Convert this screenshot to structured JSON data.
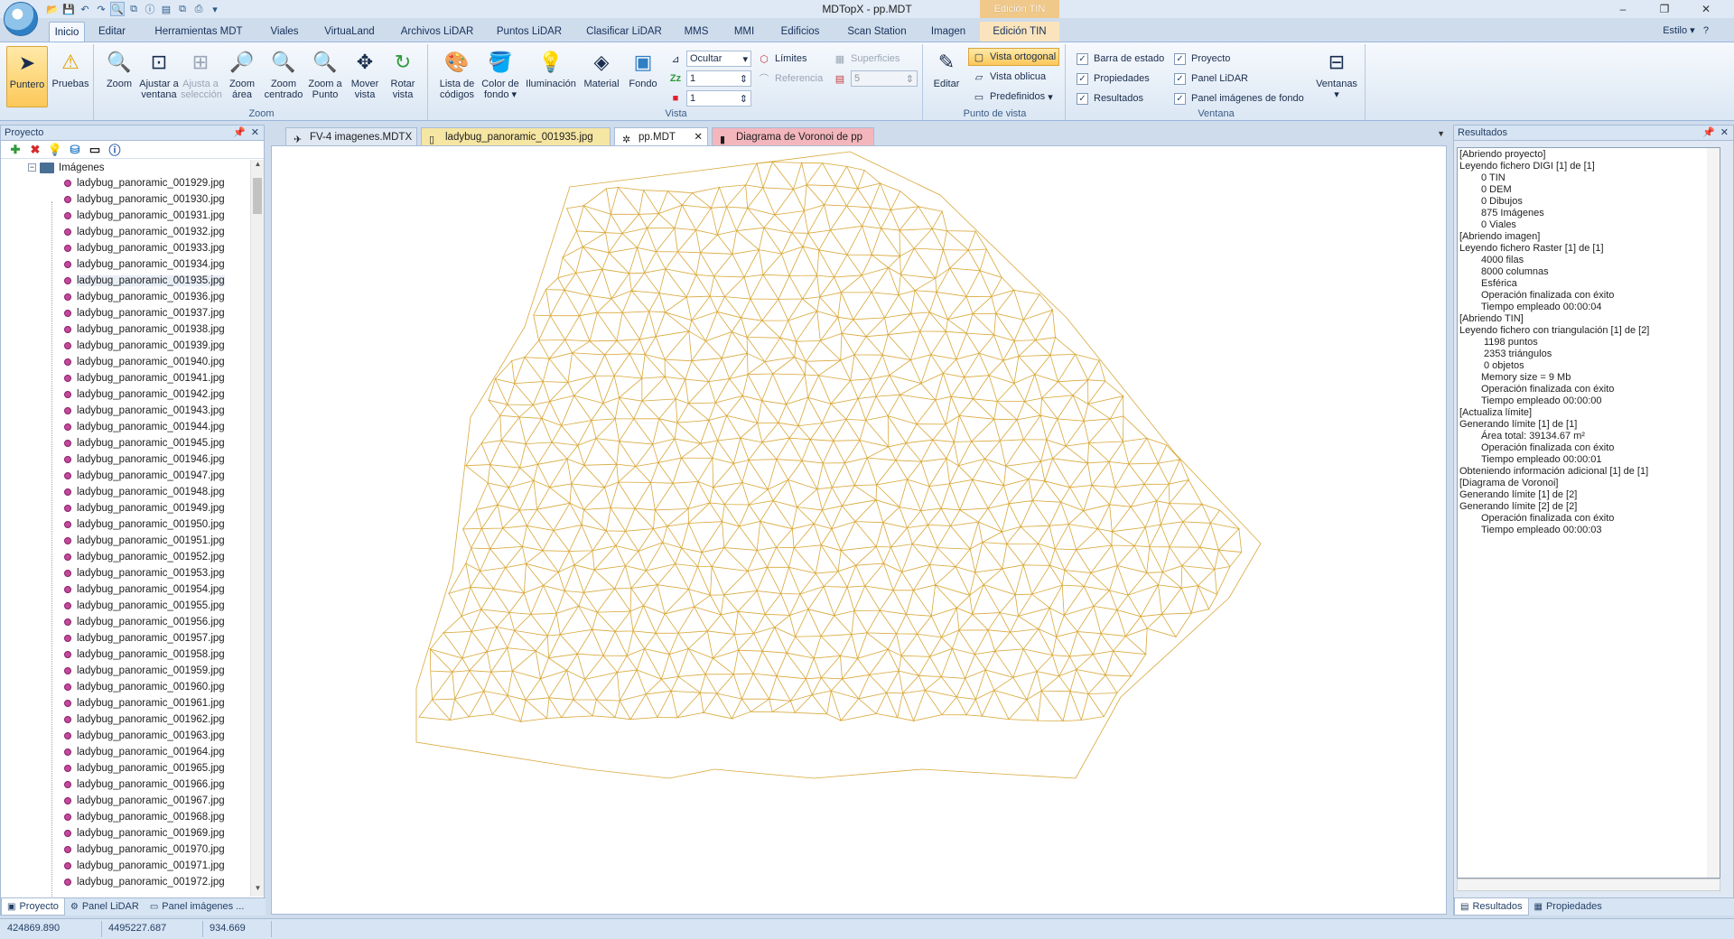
{
  "window": {
    "title": "MDTopX - pp.MDT",
    "context_tab_title": "Edición TIN",
    "minimize": "–",
    "restore": "❐",
    "close": "✕",
    "style_menu": "Estilo",
    "help": "?"
  },
  "ribbon_tabs": [
    "Inicio",
    "Editar",
    "Herramientas MDT",
    "Viales",
    "VirtuaLand",
    "Archivos LiDAR",
    "Puntos LiDAR",
    "Clasificar LiDAR",
    "MMS",
    "MMI",
    "Edificios",
    "Scan Station",
    "Imagen",
    "Edición TIN"
  ],
  "ribbon": {
    "puntero": "Puntero",
    "pruebas": "Pruebas",
    "zoom_group": {
      "label": "Zoom",
      "zoom": "Zoom",
      "ajustar_ventana": "Ajustar a ventana",
      "ajustar_seleccion": "Ajusta a selección",
      "zoom_area": "Zoom área",
      "zoom_centrado": "Zoom centrado",
      "zoom_punto": "Zoom a Punto",
      "mover_vista": "Mover vista",
      "rotar_vista": "Rotar vista"
    },
    "vista_group": {
      "label": "Vista",
      "lista_codigos": "Lista de códigos",
      "color_fondo": "Color de fondo",
      "iluminacion": "Iluminación",
      "material": "Material",
      "fondo": "Fondo",
      "ocultar": "Ocultar",
      "z_value": "1",
      "color_value": "1",
      "limites": "Límites",
      "referencia": "Referencia",
      "superficies": "Superficies",
      "superficies_value": "5"
    },
    "punto_vista_group": {
      "label": "Punto de vista",
      "editar": "Editar",
      "vista_ortogonal": "Vista ortogonal",
      "vista_oblicua": "Vista oblicua",
      "predefinidos": "Predefinidos"
    },
    "ventana_group": {
      "label": "Ventana",
      "barra_estado": "Barra de estado",
      "propiedades": "Propiedades",
      "resultados": "Resultados",
      "proyecto": "Proyecto",
      "panel_lidar": "Panel LiDAR",
      "panel_imagenes": "Panel imágenes de fondo",
      "ventanas": "Ventanas"
    }
  },
  "project_panel": {
    "title": "Proyecto",
    "root": "Imágenes",
    "items": [
      "ladybug_panoramic_001929.jpg",
      "ladybug_panoramic_001930.jpg",
      "ladybug_panoramic_001931.jpg",
      "ladybug_panoramic_001932.jpg",
      "ladybug_panoramic_001933.jpg",
      "ladybug_panoramic_001934.jpg",
      "ladybug_panoramic_001935.jpg",
      "ladybug_panoramic_001936.jpg",
      "ladybug_panoramic_001937.jpg",
      "ladybug_panoramic_001938.jpg",
      "ladybug_panoramic_001939.jpg",
      "ladybug_panoramic_001940.jpg",
      "ladybug_panoramic_001941.jpg",
      "ladybug_panoramic_001942.jpg",
      "ladybug_panoramic_001943.jpg",
      "ladybug_panoramic_001944.jpg",
      "ladybug_panoramic_001945.jpg",
      "ladybug_panoramic_001946.jpg",
      "ladybug_panoramic_001947.jpg",
      "ladybug_panoramic_001948.jpg",
      "ladybug_panoramic_001949.jpg",
      "ladybug_panoramic_001950.jpg",
      "ladybug_panoramic_001951.jpg",
      "ladybug_panoramic_001952.jpg",
      "ladybug_panoramic_001953.jpg",
      "ladybug_panoramic_001954.jpg",
      "ladybug_panoramic_001955.jpg",
      "ladybug_panoramic_001956.jpg",
      "ladybug_panoramic_001957.jpg",
      "ladybug_panoramic_001958.jpg",
      "ladybug_panoramic_001959.jpg",
      "ladybug_panoramic_001960.jpg",
      "ladybug_panoramic_001961.jpg",
      "ladybug_panoramic_001962.jpg",
      "ladybug_panoramic_001963.jpg",
      "ladybug_panoramic_001964.jpg",
      "ladybug_panoramic_001965.jpg",
      "ladybug_panoramic_001966.jpg",
      "ladybug_panoramic_001967.jpg",
      "ladybug_panoramic_001968.jpg",
      "ladybug_panoramic_001969.jpg",
      "ladybug_panoramic_001970.jpg",
      "ladybug_panoramic_001971.jpg",
      "ladybug_panoramic_001972.jpg"
    ],
    "tabs": [
      "Proyecto",
      "Panel LiDAR",
      "Panel imágenes ..."
    ]
  },
  "doc_tabs": [
    {
      "label": "FV-4 imagenes.MDTX",
      "bg": "#dfe8f3"
    },
    {
      "label": "ladybug_panoramic_001935.jpg",
      "bg": "#f6e6a3"
    },
    {
      "label": "pp.MDT",
      "bg": "#ffffff"
    },
    {
      "label": "Diagrama de Voronoi de pp",
      "bg": "#f4b6bd"
    }
  ],
  "tin": {
    "line_color": "#d9a83a"
  },
  "results_panel": {
    "title": "Resultados",
    "lines": [
      {
        "t": "[Abriendo proyecto]",
        "i": 0
      },
      {
        "t": "Leyendo fichero DIGI [1] de [1]",
        "i": 0
      },
      {
        "t": "0 TIN",
        "i": 1
      },
      {
        "t": "0 DEM",
        "i": 1
      },
      {
        "t": "0 Dibujos",
        "i": 1
      },
      {
        "t": "875 Imágenes",
        "i": 1
      },
      {
        "t": "0 Viales",
        "i": 1
      },
      {
        "t": "[Abriendo imagen]",
        "i": 0
      },
      {
        "t": "Leyendo fichero Raster [1] de [1]",
        "i": 0
      },
      {
        "t": "4000 filas",
        "i": 1
      },
      {
        "t": "8000 columnas",
        "i": 1
      },
      {
        "t": "Esférica",
        "i": 1
      },
      {
        "t": "Operación finalizada con éxito",
        "i": 1
      },
      {
        "t": "Tiempo empleado 00:00:04",
        "i": 1
      },
      {
        "t": "[Abriendo TIN]",
        "i": 0
      },
      {
        "t": "Leyendo fichero con triangulación [1] de [2]",
        "i": 0
      },
      {
        "t": "1198 puntos",
        "i": 2
      },
      {
        "t": "2353 triángulos",
        "i": 2
      },
      {
        "t": "0 objetos",
        "i": 2
      },
      {
        "t": "Memory size = 9 Mb",
        "i": 1
      },
      {
        "t": "Operación finalizada con éxito",
        "i": 1
      },
      {
        "t": "Tiempo empleado 00:00:00",
        "i": 1
      },
      {
        "t": "[Actualiza límite]",
        "i": 0
      },
      {
        "t": "Generando límite [1] de [1]",
        "i": 0
      },
      {
        "t": "Área total: 39134.67 m²",
        "i": 1
      },
      {
        "t": "Operación finalizada con éxito",
        "i": 1
      },
      {
        "t": "Tiempo empleado 00:00:01",
        "i": 1
      },
      {
        "t": "Obteniendo información adicional [1] de [1]",
        "i": 0
      },
      {
        "t": "[Diagrama de Voronoi]",
        "i": 0
      },
      {
        "t": "Generando límite [1] de [2]",
        "i": 0
      },
      {
        "t": "Generando límite [2] de [2]",
        "i": 0
      },
      {
        "t": "Operación finalizada con éxito",
        "i": 1
      },
      {
        "t": "Tiempo empleado 00:00:03",
        "i": 1
      }
    ],
    "tabs": [
      "Resultados",
      "Propiedades"
    ]
  },
  "statusbar": {
    "x": "424869.890",
    "y": "4495227.687",
    "z": "934.669"
  }
}
